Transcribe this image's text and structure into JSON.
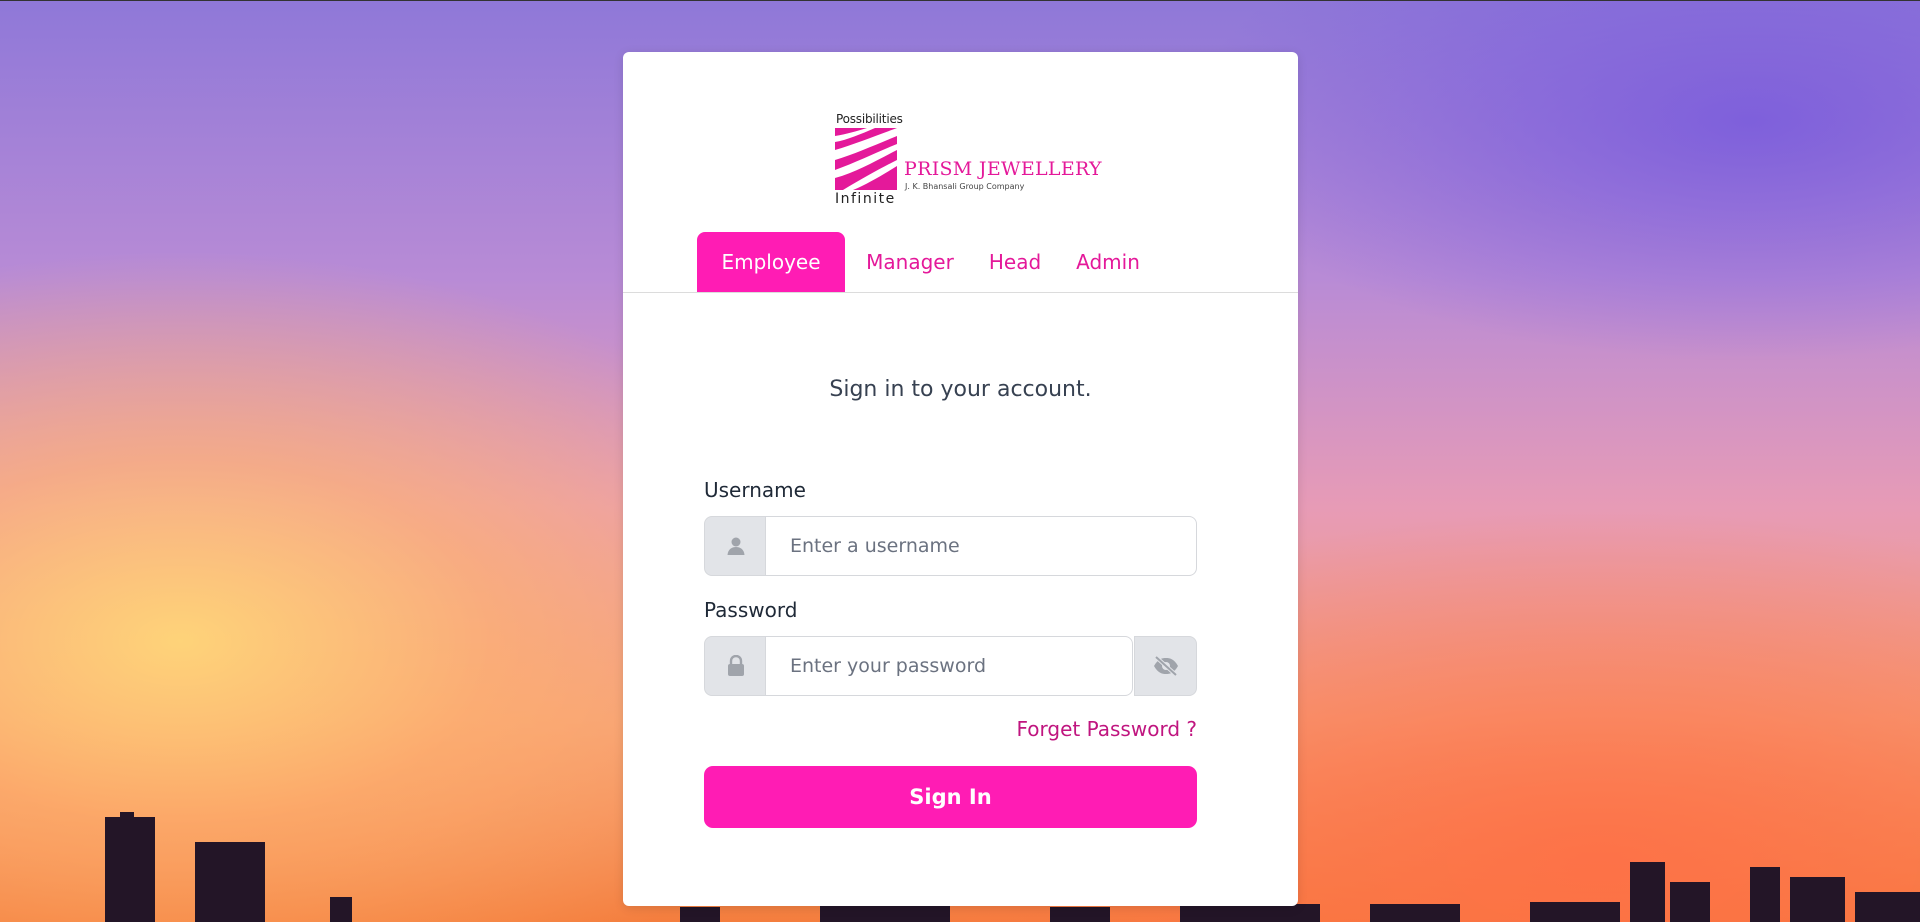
{
  "brand": {
    "tagline_top": "Possibilities",
    "tagline_bottom": "Infinite",
    "name": "PRISM JEWELLERY",
    "subtitle": "J. K. Bhansali Group Company",
    "color": "#e4199a"
  },
  "tabs": [
    {
      "label": "Employee",
      "active": true
    },
    {
      "label": "Manager",
      "active": false
    },
    {
      "label": "Head",
      "active": false
    },
    {
      "label": "Admin",
      "active": false
    }
  ],
  "form": {
    "heading": "Sign in to your account.",
    "username": {
      "label": "Username",
      "placeholder": "Enter a username",
      "value": "",
      "icon": "user-icon"
    },
    "password": {
      "label": "Password",
      "placeholder": "Enter your password",
      "value": "",
      "icon": "lock-icon",
      "toggle_icon": "eye-slash-icon"
    },
    "forgot_label": "Forget Password ?",
    "submit_label": "Sign In"
  },
  "colors": {
    "accent": "#ff1cb4",
    "link": "#c0157f"
  }
}
